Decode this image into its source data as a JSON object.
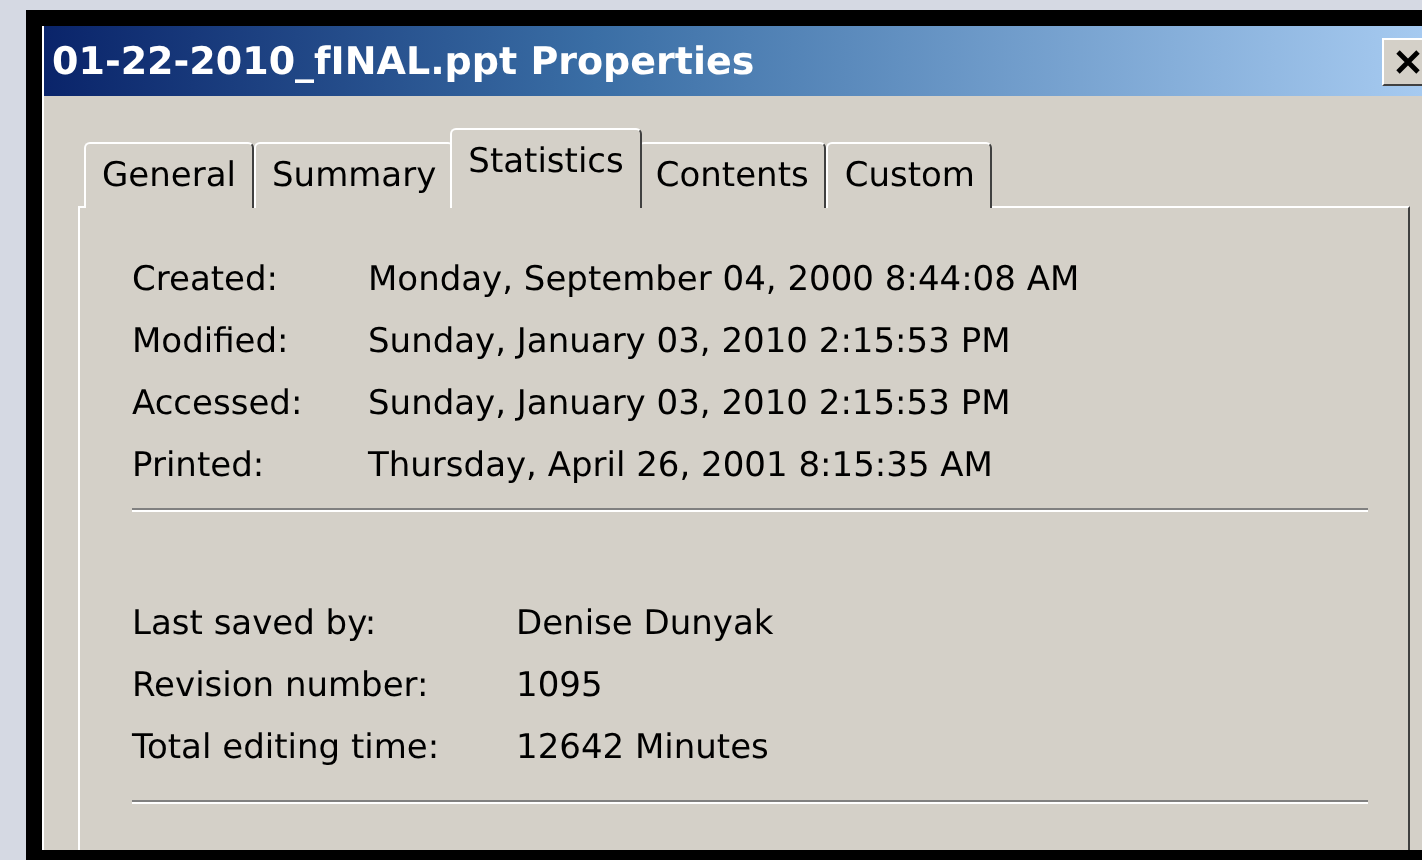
{
  "window": {
    "title": "01-22-2010_fINAL.ppt Properties"
  },
  "tabs": [
    {
      "label": "General",
      "selected": false
    },
    {
      "label": "Summary",
      "selected": false
    },
    {
      "label": "Statistics",
      "selected": true
    },
    {
      "label": "Contents",
      "selected": false
    },
    {
      "label": "Custom",
      "selected": false
    }
  ],
  "dates": [
    {
      "label": "Created:",
      "value": "Monday, September 04, 2000 8:44:08 AM"
    },
    {
      "label": "Modified:",
      "value": "Sunday, January 03, 2010 2:15:53 PM"
    },
    {
      "label": "Accessed:",
      "value": "Sunday, January 03, 2010 2:15:53 PM"
    },
    {
      "label": "Printed:",
      "value": "Thursday, April 26, 2001 8:15:35 AM"
    }
  ],
  "details": [
    {
      "label": "Last saved by:",
      "value": "Denise Dunyak"
    },
    {
      "label": "Revision number:",
      "value": "1095"
    },
    {
      "label": "Total editing time:",
      "value": "12642 Minutes"
    }
  ]
}
